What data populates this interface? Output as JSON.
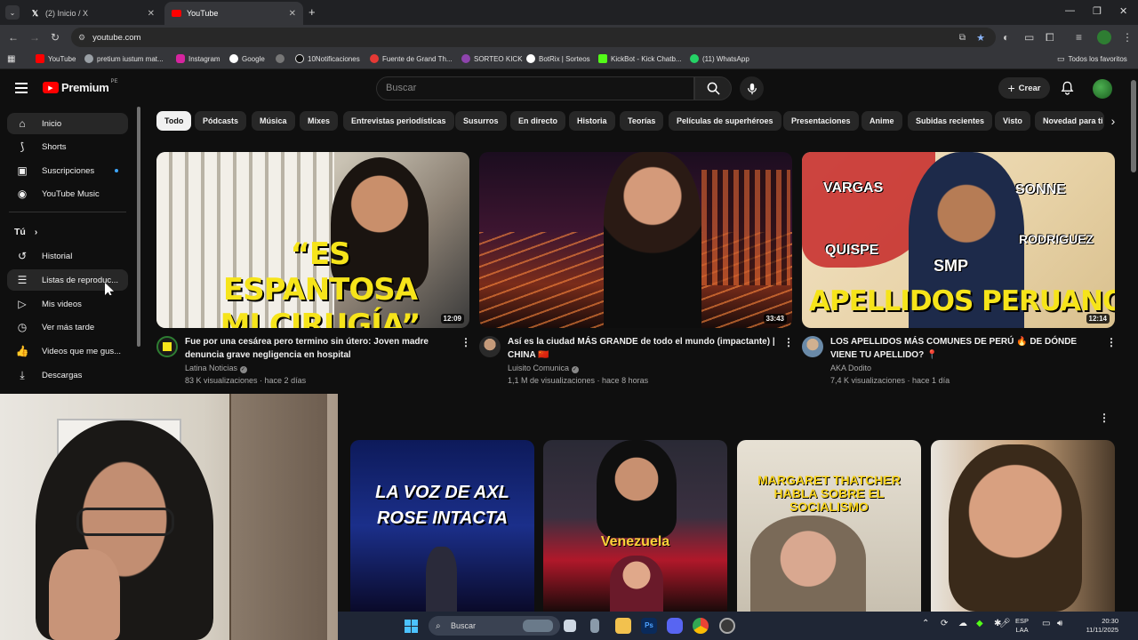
{
  "browser": {
    "tabs": [
      {
        "title": "(2) Inicio / X",
        "icon": "x-logo-icon"
      },
      {
        "title": "YouTube",
        "icon": "youtube-icon"
      }
    ],
    "url": "youtube.com",
    "bookmarks": [
      {
        "label": "YouTube",
        "color": "#ff0000"
      },
      {
        "label": "pretium iustum mat...",
        "color": "#9aa0a6"
      },
      {
        "label": "Instagram",
        "color": "#d6249f"
      },
      {
        "label": "Google",
        "color": "#ffffff"
      },
      {
        "label": "",
        "color": "#777777"
      },
      {
        "label": "10Notificaciones",
        "color": "#ffffff"
      },
      {
        "label": "Fuente de Grand Th...",
        "color": "#e53935"
      },
      {
        "label": "SORTEO KICK",
        "color": "#8e44ad"
      },
      {
        "label": "BotRix | Sorteos",
        "color": "#ffffff"
      },
      {
        "label": "KickBot - Kick Chatb...",
        "color": "#53fc18"
      },
      {
        "label": "(11) WhatsApp",
        "color": "#25d366"
      }
    ],
    "all_bookmarks": "Todos los favoritos"
  },
  "header": {
    "logo": "Premium",
    "logo_region": "PE",
    "search_placeholder": "Buscar",
    "create_label": "Crear"
  },
  "sidebar": {
    "main": [
      {
        "label": "Inicio",
        "icon": "home-icon"
      },
      {
        "label": "Shorts",
        "icon": "shorts-icon"
      },
      {
        "label": "Suscripciones",
        "icon": "subscriptions-icon"
      },
      {
        "label": "YouTube Music",
        "icon": "youtube-music-icon"
      }
    ],
    "you_heading": "Tú",
    "you_items": [
      {
        "label": "Historial",
        "icon": "history-icon"
      },
      {
        "label": "Listas de reproduc...",
        "icon": "playlists-icon"
      },
      {
        "label": "Mis videos",
        "icon": "my-videos-icon"
      },
      {
        "label": "Ver más tarde",
        "icon": "watch-later-icon"
      },
      {
        "label": "Videos que me gus...",
        "icon": "liked-videos-icon"
      },
      {
        "label": "Descargas",
        "icon": "downloads-icon"
      }
    ]
  },
  "chips": [
    "Todo",
    "Pódcasts",
    "Música",
    "Mixes",
    "Entrevistas periodísticas",
    "Susurros",
    "En directo",
    "Historia",
    "Teorías",
    "Películas de superhéroes",
    "Presentaciones",
    "Anime",
    "Subidas recientes",
    "Visto",
    "Novedad para ti"
  ],
  "videos": [
    {
      "thumb_text": "“ES ESPANTOSA MI CIRUGÍA”",
      "duration": "12:09",
      "title": "Fue por una cesárea pero termino sin útero: Joven madre denuncia grave negligencia en hospital",
      "channel": "Latina Noticias",
      "stats": "83 K visualizaciones · hace 2 días"
    },
    {
      "thumb_text": "",
      "duration": "33:43",
      "title": "Así es la ciudad MÁS GRANDE de todo el mundo (impactante) | CHINA 🇨🇳",
      "channel": "Luisito Comunica",
      "stats": "1,1 M de visualizaciones · hace 8 horas"
    },
    {
      "thumb_text": "APELLIDOS PERUANOS",
      "thumb_labels": [
        "VARGAS",
        "SONNE",
        "QUISPE",
        "RODRIGUEZ",
        "SMP"
      ],
      "duration": "12:14",
      "title": "LOS APELLIDOS MÁS COMUNES DE PERÚ 🔥 DE DÓNDE VIENE TU APELLIDO? 📍",
      "channel": "AKA Dodito",
      "stats": "7,4 K visualizaciones · hace 1 día"
    }
  ],
  "shorts": [
    {
      "thumb_text": "LA VOZ DE AXL ROSE INTACTA"
    },
    {
      "thumb_text": "Venezuela"
    },
    {
      "thumb_text": "MARGARET THATCHER HABLA SOBRE EL SOCIALISMO"
    },
    {
      "thumb_text": ""
    }
  ],
  "taskbar": {
    "search": "Buscar",
    "lang": "ESP",
    "lang2": "LAA",
    "time": "20:30",
    "date": "11/11/2025"
  }
}
